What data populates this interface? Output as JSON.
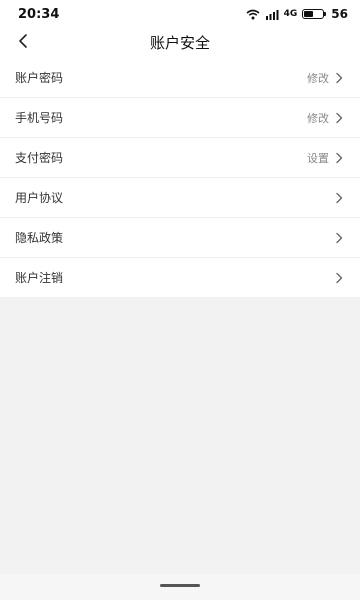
{
  "status_bar": {
    "time": "20:34",
    "network_label": "4G",
    "battery_percent": "56",
    "battery_level": 0.56
  },
  "nav": {
    "title": "账户安全"
  },
  "rows": [
    {
      "label": "账户密码",
      "action": "修改"
    },
    {
      "label": "手机号码",
      "action": "修改"
    },
    {
      "label": "支付密码",
      "action": "设置"
    },
    {
      "label": "用户协议",
      "action": ""
    },
    {
      "label": "隐私政策",
      "action": ""
    },
    {
      "label": "账户注销",
      "action": ""
    }
  ],
  "icons": {
    "back": "chevron-left-icon",
    "row_chevron": "chevron-right-icon",
    "wifi": "wifi-icon",
    "signal": "signal-icon",
    "battery": "battery-icon"
  },
  "colors": {
    "background": "#f2f2f2",
    "surface": "#ffffff",
    "secondary_text": "#888888"
  }
}
